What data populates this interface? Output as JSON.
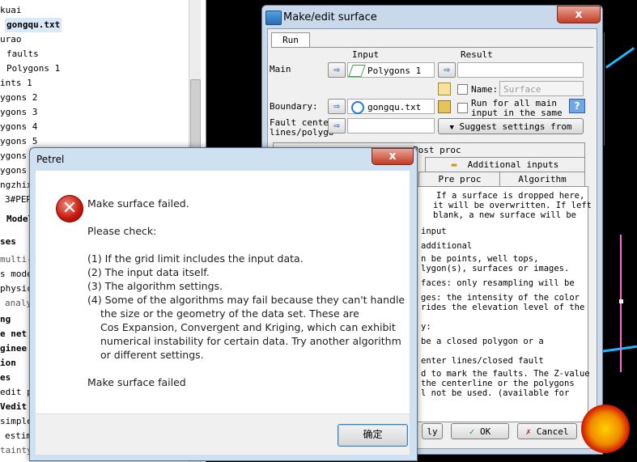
{
  "tree": {
    "items": [
      "kuai",
      "gongqu.txt",
      "urao",
      "faults",
      "Polygons 1",
      "ints 1",
      "ygons 2",
      "ygons 3",
      "ygons 4",
      "ygons 5",
      "ygons",
      "ygons",
      "ngzhix",
      "3#PER",
      "Model",
      "ses",
      "multi-",
      "s mode",
      "physic",
      "analy",
      "ng",
      "e net",
      "ginee",
      "ion",
      "es",
      "edit p",
      "Vedit",
      "simple",
      "estim",
      "tainty"
    ]
  },
  "make_surface": {
    "title": "Make/edit surface",
    "close": "x",
    "tab_run": "Run",
    "col_input": "Input",
    "col_result": "Result",
    "lbl_main": "Main",
    "main_input": "Polygons 1",
    "lbl_name": "Name:",
    "name_placeholder": "Surface",
    "lbl_boundary": "Boundary:",
    "boundary_input": "gongqu.txt",
    "run_for_all_1": "Run for all main",
    "run_for_all_2": "input in the same",
    "help_q": "?",
    "lbl_fault_1": "Fault center",
    "lbl_fault_2": "lines/polygo",
    "suggest_btn": "Suggest settings from",
    "tab_post": "Post proc",
    "tab_additional": "Additional inputs",
    "tab_pre": "Pre proc",
    "tab_algorithm": "Algorithm",
    "help_lines": [
      "If a surface is dropped here,",
      "it will be overwritten. If left",
      "blank, a new surface will be",
      "input",
      "additional",
      "n be points, well tops,",
      "lygon(s), surfaces or images.",
      "faces: only resampling will be",
      "ges: the intensity of the color",
      "rides the elevation level of the",
      "y:",
      "be a closed polygon or a",
      "enter lines/closed fault",
      "d to mark the faults. The Z-value",
      "the centerline or the polygons",
      "l not be used. (available for"
    ],
    "btn_apply": "ly",
    "btn_ok": "OK",
    "btn_cancel": "Cancel"
  },
  "dialog": {
    "title": "Petrel",
    "close": "x",
    "heading": "Make surface failed.",
    "please_check": "Please check:",
    "items": [
      "(1) If the grid limit includes the input data.",
      "(2) The input data itself.",
      "(3) The algorithm settings.",
      "(4) Some of the algorithms may fail because they can't handle",
      "the size or the geometry of the data set. These are",
      "Cos Expansion, Convergent and Kriging, which can exhibit",
      "numerical instability for certain data. Try another algorithm",
      "or different settings."
    ],
    "footer_text": "Make surface failed",
    "ok": "确定"
  }
}
